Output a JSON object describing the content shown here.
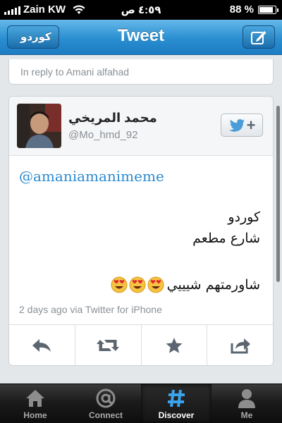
{
  "status_bar": {
    "carrier": "Zain KW",
    "time": "٤:٥٩ ص",
    "battery": "88 %",
    "battery_level": 0.88
  },
  "nav": {
    "back_label": "كوردو",
    "title": "Tweet",
    "compose_icon": "compose-icon"
  },
  "reply": {
    "text": "In reply to Amani alfahad"
  },
  "tweet": {
    "display_name": "محمد المريخي",
    "handle": "@Mo_hmd_92",
    "mention": "@amaniamanimeme",
    "lines": [
      "كوردو",
      "شارع مطعم",
      "شاورمتهم شيييي"
    ],
    "emoji_count": 3,
    "meta": "2 days ago via Twitter for iPhone",
    "actions": [
      "reply-icon",
      "retweet-icon",
      "favorite-icon",
      "share-icon"
    ]
  },
  "tabs": [
    {
      "label": "Home",
      "icon": "home-icon"
    },
    {
      "label": "Connect",
      "icon": "at-icon"
    },
    {
      "label": "Discover",
      "icon": "hashtag-icon"
    },
    {
      "label": "Me",
      "icon": "person-icon"
    }
  ],
  "colors": {
    "nav_blue": "#2a8ed0",
    "link_blue": "#2b8ad1",
    "tab_bar": "#1b1b1b"
  }
}
